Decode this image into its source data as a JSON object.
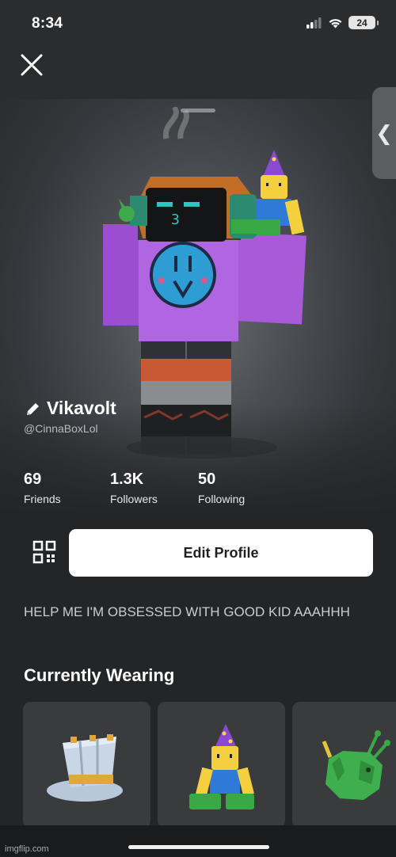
{
  "status_bar": {
    "time": "8:34",
    "battery": "24"
  },
  "profile": {
    "display_name": "Vikavolt",
    "username": "@CinnaBoxLol",
    "bio": "HELP ME I'M OBSESSED WITH GOOD KID AAAHHH"
  },
  "stats": [
    {
      "value": "69",
      "label": "Friends"
    },
    {
      "value": "1.3K",
      "label": "Followers"
    },
    {
      "value": "50",
      "label": "Following"
    }
  ],
  "actions": {
    "edit_profile": "Edit Profile"
  },
  "wearing": {
    "title": "Currently Wearing"
  },
  "watermark": "imgflip.com",
  "icons": [
    "close-icon",
    "chevron-left-icon",
    "pencil-icon",
    "qr-code-icon",
    "signal-icon",
    "wifi-icon",
    "battery-icon"
  ],
  "colors": {
    "background": "#232527",
    "button": "#ffffff",
    "card": "#393b3d",
    "shirt": "#a259d9"
  }
}
